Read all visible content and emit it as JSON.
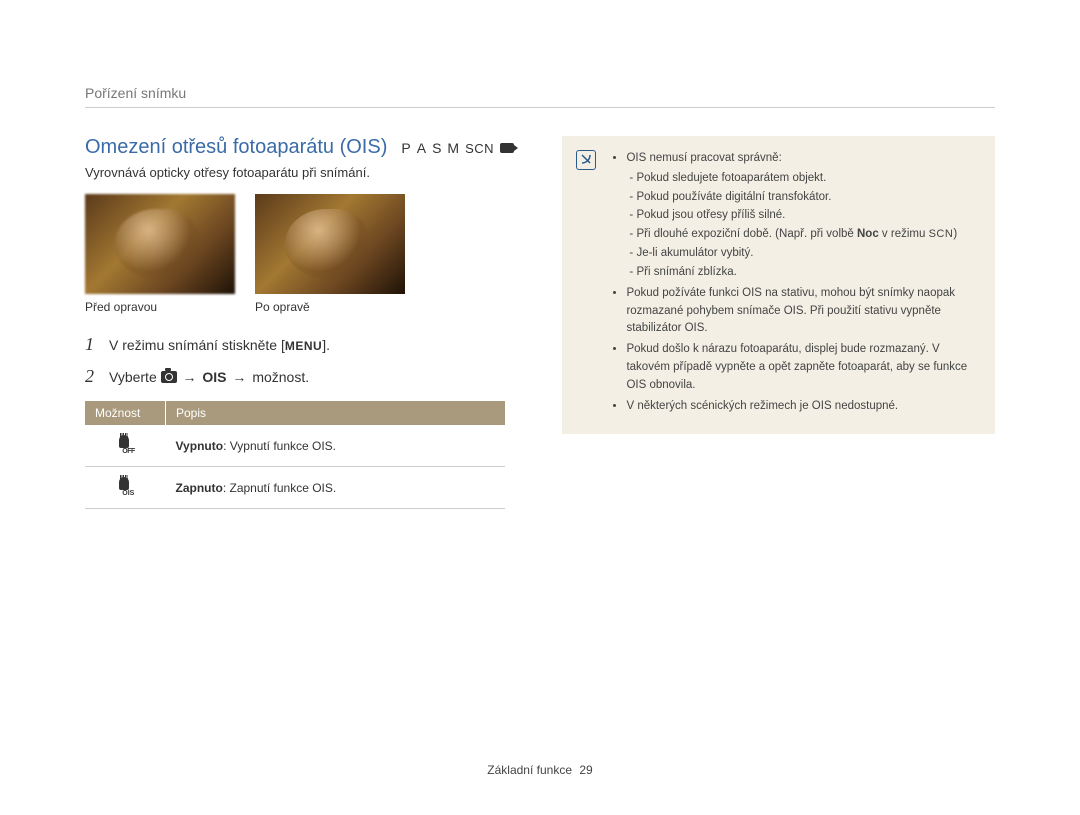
{
  "breadcrumb": "Pořízení snímku",
  "title": "Omezení otřesů fotoaparátu (OIS)",
  "mode_labels": {
    "p": "P",
    "a": "A",
    "s": "S",
    "m": "M",
    "scn": "SCN"
  },
  "subtitle": "Vyrovnává opticky otřesy fotoaparátu při snímání.",
  "images": {
    "before_caption": "Před opravou",
    "after_caption": "Po opravě"
  },
  "steps": [
    {
      "num": "1",
      "text_prefix": "V režimu snímání stiskněte [",
      "menu": "MENU",
      "text_suffix": "]."
    },
    {
      "num": "2",
      "text_prefix": "Vyberte ",
      "camera": true,
      "arrow1": " → ",
      "bold": "OIS",
      "arrow2": " → ",
      "rest": "možnost."
    }
  ],
  "table": {
    "header_option": "Možnost",
    "header_desc": "Popis",
    "rows": [
      {
        "icon_sub": "OFF",
        "bold": "Vypnuto",
        "desc": ": Vypnutí funkce OIS."
      },
      {
        "icon_sub": "OIS",
        "bold": "Zapnuto",
        "desc": ": Zapnutí funkce OIS."
      }
    ]
  },
  "note": {
    "intro": "OIS nemusí pracovat správně:",
    "sub": [
      "Pokud sledujete fotoaparátem objekt.",
      "Pokud používáte digitální transfokátor.",
      "Pokud jsou otřesy příliš silné.",
      {
        "pre": "Při dlouhé expoziční době. (Např. při volbě ",
        "bold": "Noc",
        "mid": " v režimu ",
        "scn": "SCN",
        "post": ")"
      },
      "Je-li akumulátor vybitý.",
      "Při snímání zblízka."
    ],
    "bullets": [
      "Pokud požíváte funkci OIS na stativu, mohou být snímky naopak rozmazané pohybem snímače OIS. Při použití stativu vypněte stabilizátor OIS.",
      "Pokud došlo k nárazu fotoaparátu, displej bude rozmazaný. V takovém případě vypněte a opět zapněte fotoaparát, aby se funkce OIS obnovila.",
      "V některých scénických režimech je OIS nedostupné."
    ]
  },
  "footer": {
    "text": "Základní funkce",
    "page": "29"
  }
}
